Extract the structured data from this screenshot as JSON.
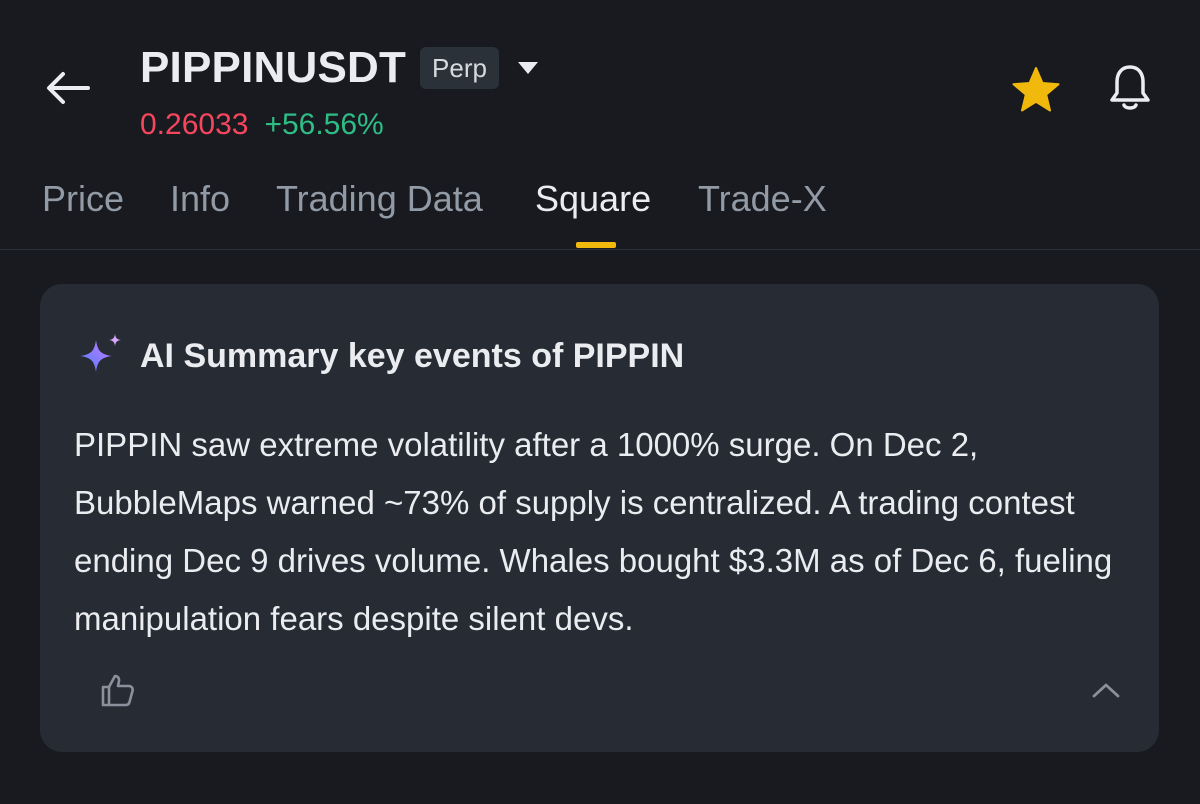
{
  "header": {
    "symbol": "PIPPINUSDT",
    "contract_type": "Perp",
    "price": "0.26033",
    "change": "+56.56%",
    "icons": {
      "back": "arrow-left-icon",
      "dropdown": "caret-down-icon",
      "favorite": "star-icon",
      "alert": "bell-icon"
    }
  },
  "tabs": [
    {
      "label": "Price"
    },
    {
      "label": "Info"
    },
    {
      "label": "Trading Data"
    },
    {
      "label": "Square",
      "active": true
    },
    {
      "label": "Trade-X"
    }
  ],
  "summary_card": {
    "title": "AI Summary key events of PIPPIN",
    "body": "PIPPIN saw extreme volatility after a 1000% surge. On Dec 2, BubbleMaps warned ~73% of supply is centralized. A trading contest ending Dec 9 drives volume. Whales bought $3.3M as of Dec 6, fueling manipulation fears despite silent devs.",
    "icons": {
      "title": "sparkle-icon",
      "like": "thumbs-up-icon",
      "collapse": "chevron-up-icon"
    }
  },
  "colors": {
    "background": "#181a20",
    "card": "#262b34",
    "price_down": "#f6465d",
    "price_up": "#2ebd85",
    "accent": "#f0b90b"
  }
}
